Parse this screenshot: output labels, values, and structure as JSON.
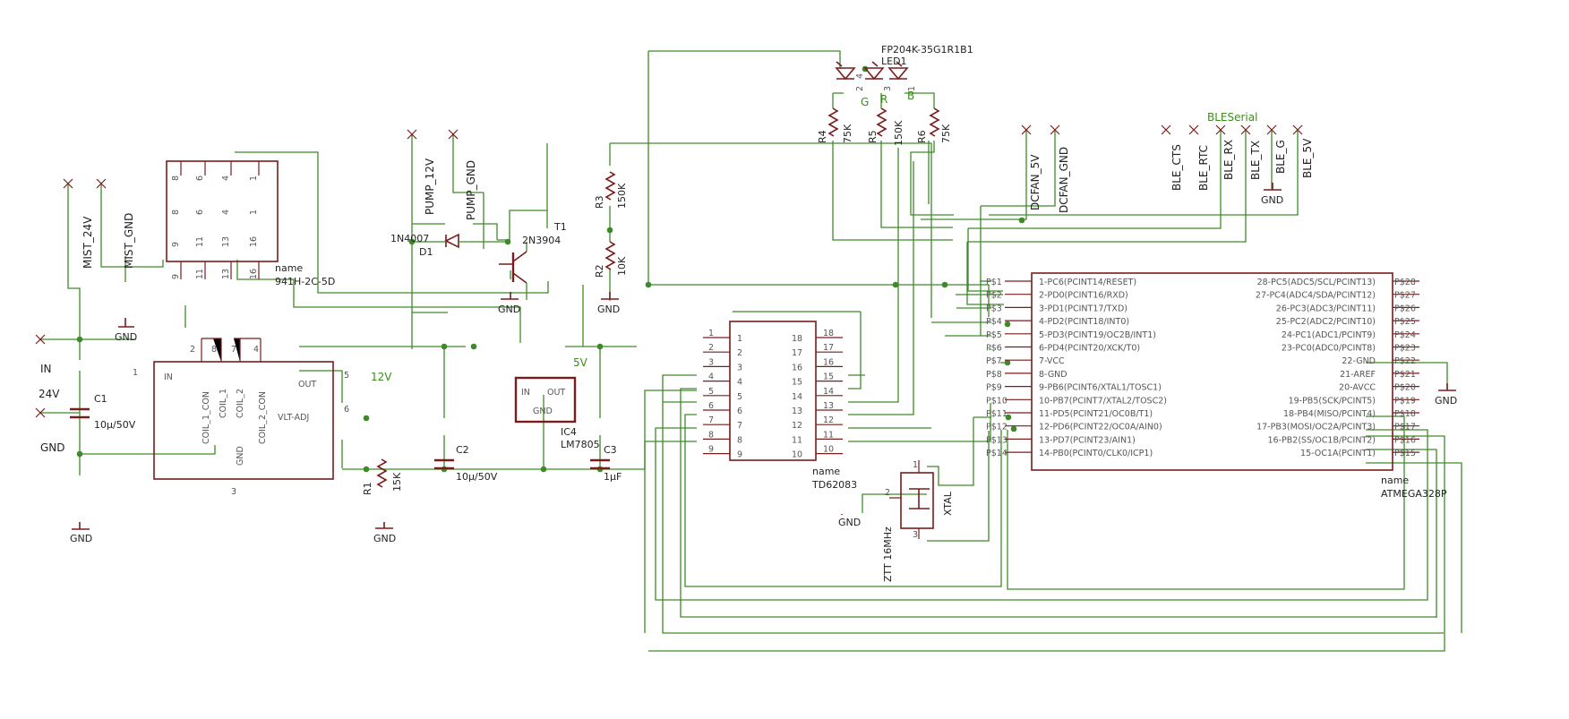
{
  "colors": {
    "wire": "#3e8a2a",
    "part": "#7a1c1c",
    "net_label": "#3c8c1e",
    "background": "#ffffff"
  },
  "connectors": {
    "mist_24v": "MIST_24V",
    "mist_gnd": "MIST_GND",
    "pump_12v": "PUMP_12V",
    "pump_gnd": "PUMP_GND",
    "dcfan_5v": "DCFAN_5V",
    "dcfan_gnd": "DCFAN_GND",
    "in": "IN",
    "in_24v": "24V",
    "gnd_in": "GND"
  },
  "nets": {
    "v12": "12V",
    "v5": "5V"
  },
  "gnd_symbols": [
    "GND",
    "GND",
    "GND",
    "GND",
    "GND",
    "GND",
    "GND",
    "GND"
  ],
  "relay": {
    "name_label": "name",
    "part_value": "941H-2C-5D",
    "top_pins": [
      "8",
      "6",
      "4",
      "1"
    ],
    "bottom_pins": [
      "9",
      "11",
      "13",
      "16"
    ]
  },
  "drv": {
    "pins_top": [
      "2",
      "8",
      "7",
      "4"
    ],
    "pin_in": "1",
    "pin_out": "5",
    "pin_adj": "6",
    "pin_gnd": "3",
    "in": "IN",
    "out": "OUT",
    "adj": "VLT-ADJ",
    "gnd": "GND",
    "coils": [
      "COIL_1_CON",
      "COIL_1",
      "COIL_2",
      "COIL_2_CON"
    ]
  },
  "c1": {
    "ref": "C1",
    "value": "10µ/50V"
  },
  "c2": {
    "ref": "C2",
    "value": "10µ/50V"
  },
  "c3": {
    "ref": "C3",
    "value": "1µF"
  },
  "r1": {
    "ref": "R1",
    "value": "15K"
  },
  "r2": {
    "ref": "R2",
    "value": "10K"
  },
  "r3": {
    "ref": "R3",
    "value": "150K"
  },
  "r4": {
    "ref": "R4",
    "value": "75K"
  },
  "r5": {
    "ref": "R5",
    "value": "150K"
  },
  "r6": {
    "ref": "R6",
    "value": "75K"
  },
  "d1": {
    "ref": "D1",
    "value": "1N4007"
  },
  "t1": {
    "ref": "T1",
    "value": "2N3904"
  },
  "ic4": {
    "ref": "IC4",
    "value": "LM7805",
    "in": "IN",
    "out": "OUT",
    "gnd": "GND"
  },
  "led": {
    "part": "FP204K-35G1R1B1",
    "ref": "LED1",
    "colors": [
      "G",
      "R",
      "B"
    ],
    "pins": [
      "4",
      "2",
      "3",
      "1"
    ]
  },
  "ble": {
    "title": "BLESerial",
    "pins": [
      "BLE_CTS",
      "BLE_RTC",
      "BLE_RX",
      "BLE_TX",
      "BLE_G",
      "BLE_5V"
    ]
  },
  "td": {
    "name_label": "name",
    "part": "TD62083",
    "left_pins": [
      "1",
      "2",
      "3",
      "4",
      "5",
      "6",
      "7",
      "8",
      "9"
    ],
    "right_pins": [
      "18",
      "17",
      "16",
      "15",
      "14",
      "13",
      "12",
      "11",
      "10"
    ]
  },
  "xtal": {
    "label": "XTAL",
    "value": "ZTT 16MHz",
    "pins": [
      "1",
      "2",
      "3"
    ]
  },
  "mcu": {
    "name_label": "name",
    "part": "ATMEGA328P",
    "left_pads": [
      "P$1",
      "P$2",
      "P$3",
      "P$4",
      "P$5",
      "P$6",
      "P$7",
      "P$8",
      "P$9",
      "P$10",
      "P$11",
      "P$12",
      "P$13",
      "P$14"
    ],
    "right_pads": [
      "P$28",
      "P$27",
      "P$26",
      "P$25",
      "P$24",
      "P$23",
      "P$22",
      "P$21",
      "P$20",
      "P$19",
      "P$18",
      "P$17",
      "P$16",
      "P$15"
    ],
    "left_labels": [
      "1-PC6(PCINT14/RESET)",
      "2-PD0(PCINT16/RXD)",
      "3-PD1(PCINT17/TXD)",
      "4-PD2(PCINT18/INT0)",
      "5-PD3(PCINT19/OC2B/INT1)",
      "6-PD4(PCINT20/XCK/T0)",
      "7-VCC",
      "8-GND",
      "9-PB6(PCINT6/XTAL1/TOSC1)",
      "10-PB7(PCINT7/XTAL2/TOSC2)",
      "11-PD5(PCINT21/OC0B/T1)",
      "12-PD6(PCINT22/OC0A/AIN0)",
      "13-PD7(PCINT23/AIN1)",
      "14-PB0(PCINT0/CLK0/ICP1)"
    ],
    "right_labels": [
      "28-PC5(ADC5/SCL/PCINT13)",
      "27-PC4(ADC4/SDA/PCINT12)",
      "26-PC3(ADC3/PCINT11)",
      "25-PC2(ADC2/PCINT10)",
      "24-PC1(ADC1/PCINT9)",
      "23-PC0(ADC0/PCINT8)",
      "22-GND",
      "21-AREF",
      "20-AVCC",
      "19-PB5(SCK/PCINT5)",
      "18-PB4(MISO/PCINT4)",
      "17-PB3(MOSI/OC2A/PCINT3)",
      "16-PB2(SS/OC1B/PCINT2)",
      "15-OC1A(PCINT1)"
    ]
  }
}
